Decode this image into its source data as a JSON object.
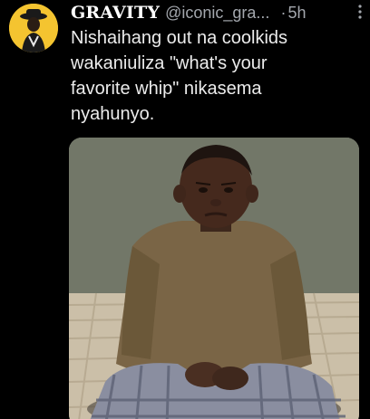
{
  "tweet": {
    "author": {
      "display_name": "GRAVITY",
      "handle": "@iconic_gra...",
      "avatar_icon": "profile-avatar"
    },
    "separator": "·",
    "time": "5h",
    "more_icon": "more-vertical-icon",
    "text": "Nishaihang out na coolkids\nwakaniuliza \"what's your\nfavorite whip\" nikasema\nnyahunyo.",
    "media": {
      "kind": "photo",
      "background_color": "#6b7066"
    }
  },
  "colors": {
    "background": "#000000",
    "name": "#ffffff",
    "secondary_text": "#a3a7ad",
    "body_text": "#ececec",
    "avatar_bg": "#f4c430"
  }
}
